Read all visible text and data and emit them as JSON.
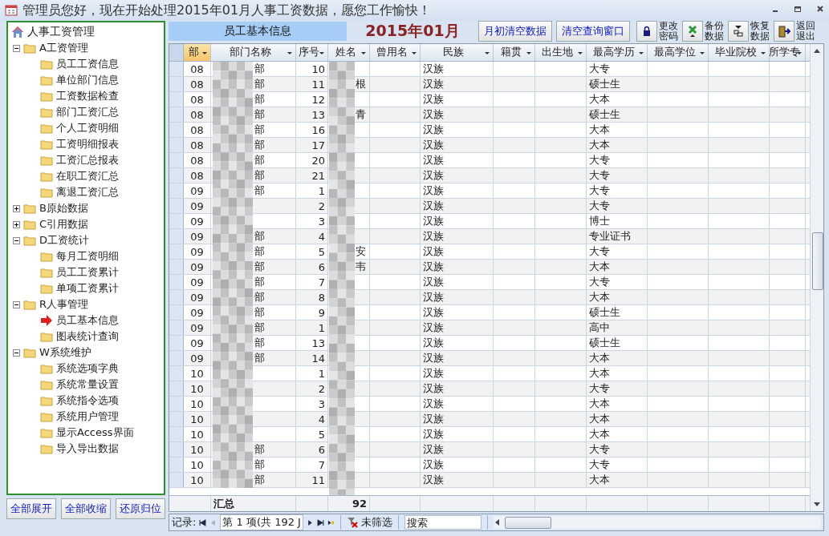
{
  "window": {
    "title": "管理员您好，现在开始处理2015年01月人事工资数据，愿您工作愉快！"
  },
  "tree": {
    "root": "人事工资管理",
    "items": [
      {
        "label": "A工资管理",
        "expanded": true,
        "children": [
          {
            "label": "员工工资信息",
            "selected": false
          },
          {
            "label": "单位部门信息",
            "selected": false
          },
          {
            "label": "工资数据检查",
            "selected": false
          },
          {
            "label": "部门工资汇总",
            "selected": false
          },
          {
            "label": "个人工资明细",
            "selected": false
          },
          {
            "label": "工资明细报表",
            "selected": false
          },
          {
            "label": "工资汇总报表",
            "selected": false
          },
          {
            "label": "在职工资汇总",
            "selected": false
          },
          {
            "label": "离退工资汇总",
            "selected": false
          }
        ]
      },
      {
        "label": "B原始数据",
        "expanded": false
      },
      {
        "label": "C引用数据",
        "expanded": false
      },
      {
        "label": "D工资统计",
        "expanded": true,
        "children": [
          {
            "label": "每月工资明细",
            "selected": false
          },
          {
            "label": "员工工资累计",
            "selected": false
          },
          {
            "label": "单项工资累计",
            "selected": false
          }
        ]
      },
      {
        "label": "R人事管理",
        "expanded": true,
        "children": [
          {
            "label": "员工基本信息",
            "selected": true
          },
          {
            "label": "图表统计查询",
            "selected": false
          }
        ]
      },
      {
        "label": "W系统维护",
        "expanded": true,
        "children": [
          {
            "label": "系统选项字典",
            "selected": false
          },
          {
            "label": "系统常量设置",
            "selected": false
          },
          {
            "label": "系统指令选项",
            "selected": false
          },
          {
            "label": "系统用户管理",
            "selected": false
          },
          {
            "label": "显示Access界面",
            "selected": false
          },
          {
            "label": "导入导出数据",
            "selected": false
          }
        ]
      }
    ]
  },
  "tree_buttons": [
    "全部展开",
    "全部收缩",
    "还原归位"
  ],
  "form_title": "员工基本信息",
  "period": "2015年01月",
  "text_buttons": [
    "月初清空数据",
    "清空查询窗口"
  ],
  "icon_buttons": [
    {
      "kind": "lock",
      "lines": [
        "更改",
        "密码"
      ]
    },
    {
      "kind": "backup",
      "lines": [
        "备份",
        "数据"
      ]
    },
    {
      "kind": "restore",
      "lines": [
        "恢复",
        "数据"
      ]
    },
    {
      "kind": "exit",
      "lines": [
        "返回",
        "退出"
      ]
    }
  ],
  "table": {
    "columns": [
      {
        "label": "部",
        "selected": true
      },
      {
        "label": "部门名称",
        "selected": false
      },
      {
        "label": "序号",
        "selected": false
      },
      {
        "label": "姓名",
        "selected": false
      },
      {
        "label": "曾用名",
        "selected": false
      },
      {
        "label": "民族",
        "selected": false
      },
      {
        "label": "籍贯",
        "selected": false
      },
      {
        "label": "出生地",
        "selected": false
      },
      {
        "label": "最高学历",
        "selected": false
      },
      {
        "label": "最高学位",
        "selected": false
      },
      {
        "label": "毕业院校",
        "selected": false
      },
      {
        "label": "所学专",
        "selected": false
      }
    ],
    "rows": [
      [
        "08",
        "部",
        "10",
        "",
        "",
        "汉族",
        "",
        "",
        "大专",
        "",
        "",
        ""
      ],
      [
        "08",
        "部",
        "11",
        "根",
        "",
        "汉族",
        "",
        "",
        "硕士生",
        "",
        "",
        ""
      ],
      [
        "08",
        "部",
        "12",
        "",
        "",
        "汉族",
        "",
        "",
        "大本",
        "",
        "",
        ""
      ],
      [
        "08",
        "部",
        "13",
        "青",
        "",
        "汉族",
        "",
        "",
        "硕士生",
        "",
        "",
        ""
      ],
      [
        "08",
        "部",
        "16",
        "",
        "",
        "汉族",
        "",
        "",
        "大本",
        "",
        "",
        ""
      ],
      [
        "08",
        "部",
        "17",
        "",
        "",
        "汉族",
        "",
        "",
        "大本",
        "",
        "",
        ""
      ],
      [
        "08",
        "部",
        "20",
        "",
        "",
        "汉族",
        "",
        "",
        "大专",
        "",
        "",
        ""
      ],
      [
        "08",
        "部",
        "21",
        "",
        "",
        "汉族",
        "",
        "",
        "大专",
        "",
        "",
        ""
      ],
      [
        "09",
        "部",
        "1",
        "",
        "",
        "汉族",
        "",
        "",
        "大专",
        "",
        "",
        ""
      ],
      [
        "09",
        "",
        "2",
        "",
        "",
        "汉族",
        "",
        "",
        "大专",
        "",
        "",
        ""
      ],
      [
        "09",
        "",
        "3",
        "",
        "",
        "汉族",
        "",
        "",
        "博士",
        "",
        "",
        ""
      ],
      [
        "09",
        "部",
        "4",
        "",
        "",
        "汉族",
        "",
        "",
        "专业证书",
        "",
        "",
        ""
      ],
      [
        "09",
        "部",
        "5",
        "安",
        "",
        "汉族",
        "",
        "",
        "大专",
        "",
        "",
        ""
      ],
      [
        "09",
        "部",
        "6",
        "韦",
        "",
        "汉族",
        "",
        "",
        "大本",
        "",
        "",
        ""
      ],
      [
        "09",
        "部",
        "7",
        "",
        "",
        "汉族",
        "",
        "",
        "大专",
        "",
        "",
        ""
      ],
      [
        "09",
        "部",
        "8",
        "",
        "",
        "汉族",
        "",
        "",
        "大本",
        "",
        "",
        ""
      ],
      [
        "09",
        "部",
        "9",
        "",
        "",
        "汉族",
        "",
        "",
        "硕士生",
        "",
        "",
        ""
      ],
      [
        "09",
        "部",
        "1",
        "",
        "",
        "汉族",
        "",
        "",
        "高中",
        "",
        "",
        ""
      ],
      [
        "09",
        "部",
        "13",
        "",
        "",
        "汉族",
        "",
        "",
        "硕士生",
        "",
        "",
        ""
      ],
      [
        "09",
        "部",
        "14",
        "",
        "",
        "汉族",
        "",
        "",
        "大本",
        "",
        "",
        ""
      ],
      [
        "10",
        "",
        "1",
        "",
        "",
        "汉族",
        "",
        "",
        "大本",
        "",
        "",
        ""
      ],
      [
        "10",
        "",
        "2",
        "",
        "",
        "汉族",
        "",
        "",
        "大专",
        "",
        "",
        ""
      ],
      [
        "10",
        "",
        "3",
        "",
        "",
        "汉族",
        "",
        "",
        "大本",
        "",
        "",
        ""
      ],
      [
        "10",
        "",
        "4",
        "",
        "",
        "汉族",
        "",
        "",
        "大本",
        "",
        "",
        ""
      ],
      [
        "10",
        "",
        "5",
        "",
        "",
        "汉族",
        "",
        "",
        "大本",
        "",
        "",
        ""
      ],
      [
        "10",
        "部",
        "6",
        "",
        "",
        "汉族",
        "",
        "",
        "大专",
        "",
        "",
        ""
      ],
      [
        "10",
        "部",
        "7",
        "",
        "",
        "汉族",
        "",
        "",
        "大专",
        "",
        "",
        ""
      ],
      [
        "10",
        "部",
        "11",
        "",
        "",
        "汉族",
        "",
        "",
        "大本",
        "",
        "",
        ""
      ]
    ],
    "total_label": "汇总",
    "total_value": "92"
  },
  "navigator": {
    "label": "记录:",
    "position": "第 1 项(共 192 J",
    "filter": "未筛选",
    "search_placeholder": "搜索"
  }
}
